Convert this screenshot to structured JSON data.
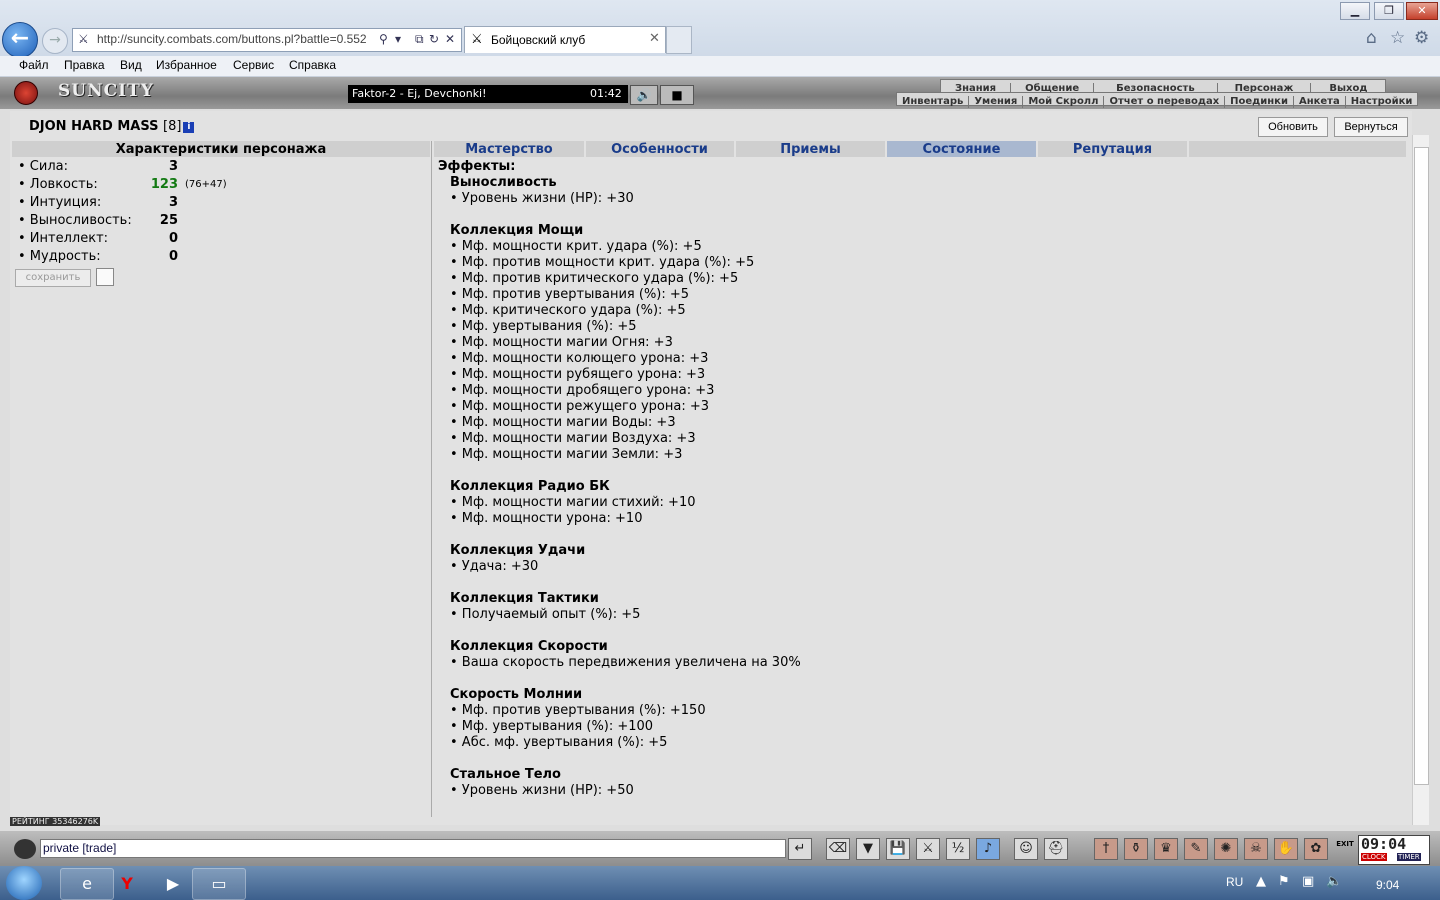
{
  "browser": {
    "url": "http://suncity.combats.com/buttons.pl?battle=0.552",
    "tab_title": "Бойцовский клуб",
    "menu": [
      "Файл",
      "Правка",
      "Вид",
      "Избранное",
      "Сервис",
      "Справка"
    ]
  },
  "game_header": {
    "logo": "SUNCITY",
    "radio_track": "Faktor-2 - Ej, Devchonki!",
    "radio_time": "01:42",
    "nav_row1": [
      "Знания",
      "Общение",
      "Безопасность",
      "Персонаж",
      "Выход"
    ],
    "nav_row2": [
      "Инвентарь",
      "Умения",
      "Мой Скролл",
      "Отчет о переводах",
      "Поединки",
      "Анкета",
      "Настройки"
    ]
  },
  "character": {
    "name": "DJON HARD MASS",
    "level": "[8]",
    "refresh_label": "Обновить",
    "return_label": "Вернуться"
  },
  "stats": {
    "title": "Характеристики персонажа",
    "rows": [
      {
        "name": "• Сила:",
        "value": "3",
        "bonus": ""
      },
      {
        "name": "• Ловкость:",
        "value": "123",
        "bonus": "(76+47)"
      },
      {
        "name": "• Интуиция:",
        "value": "3",
        "bonus": ""
      },
      {
        "name": "• Выносливость:",
        "value": "25",
        "bonus": ""
      },
      {
        "name": "• Интеллект:",
        "value": "0",
        "bonus": ""
      },
      {
        "name": "• Мудрость:",
        "value": "0",
        "bonus": ""
      }
    ],
    "save_label": "сохранить",
    "boosted_color": "#137a13"
  },
  "tabs": [
    "Мастерство",
    "Особенности",
    "Приемы",
    "Состояние",
    "Репутация"
  ],
  "active_tab": "Состояние",
  "effects": {
    "title": "Эффекты:",
    "groups": [
      {
        "title": "Выносливость",
        "items": [
          "• Уровень жизни (HP): +30"
        ]
      },
      {
        "title": "Коллекция Мощи",
        "items": [
          "• Мф. мощности крит. удара (%): +5",
          "• Мф. против мощности крит. удара (%): +5",
          "• Мф. против критического удара (%): +5",
          "• Мф. против увертывания (%): +5",
          "• Мф. критического удара (%): +5",
          "• Мф. увертывания (%): +5",
          "• Мф. мощности магии Огня: +3",
          "• Мф. мощности колющего урона: +3",
          "• Мф. мощности рубящего урона: +3",
          "• Мф. мощности дробящего урона: +3",
          "• Мф. мощности режущего урона: +3",
          "• Мф. мощности магии Воды: +3",
          "• Мф. мощности магии Воздуха: +3",
          "• Мф. мощности магии Земли: +3"
        ]
      },
      {
        "title": "Коллекция Радио БК",
        "items": [
          "• Мф. мощности магии стихий: +10",
          "• Мф. мощности урона: +10"
        ]
      },
      {
        "title": "Коллекция Удачи",
        "items": [
          "• Удача: +30"
        ]
      },
      {
        "title": "Коллекция Тактики",
        "items": [
          "• Получаемый опыт (%): +5"
        ]
      },
      {
        "title": "Коллекция Скорости",
        "items": [
          "• Ваша скорость передвижения увеличена на 30%"
        ]
      },
      {
        "title": "Скорость Молнии",
        "items": [
          "• Мф. против увертывания (%): +150",
          "• Мф. увертывания (%): +100",
          "• Абс. мф. увертывания (%): +5"
        ]
      },
      {
        "title": "Стальное Тело",
        "items": [
          "• Уровень жизни (HP): +50"
        ]
      }
    ]
  },
  "rating_text": "РЕЙТИНГ 35346276K",
  "chat": {
    "input_value": "private [trade]",
    "clock_time": "09:04",
    "clock_label": "CLOCK",
    "timer_label": "TIMER",
    "exit_label": "EXIT"
  },
  "taskbar": {
    "lang": "RU",
    "time": "9:04"
  }
}
